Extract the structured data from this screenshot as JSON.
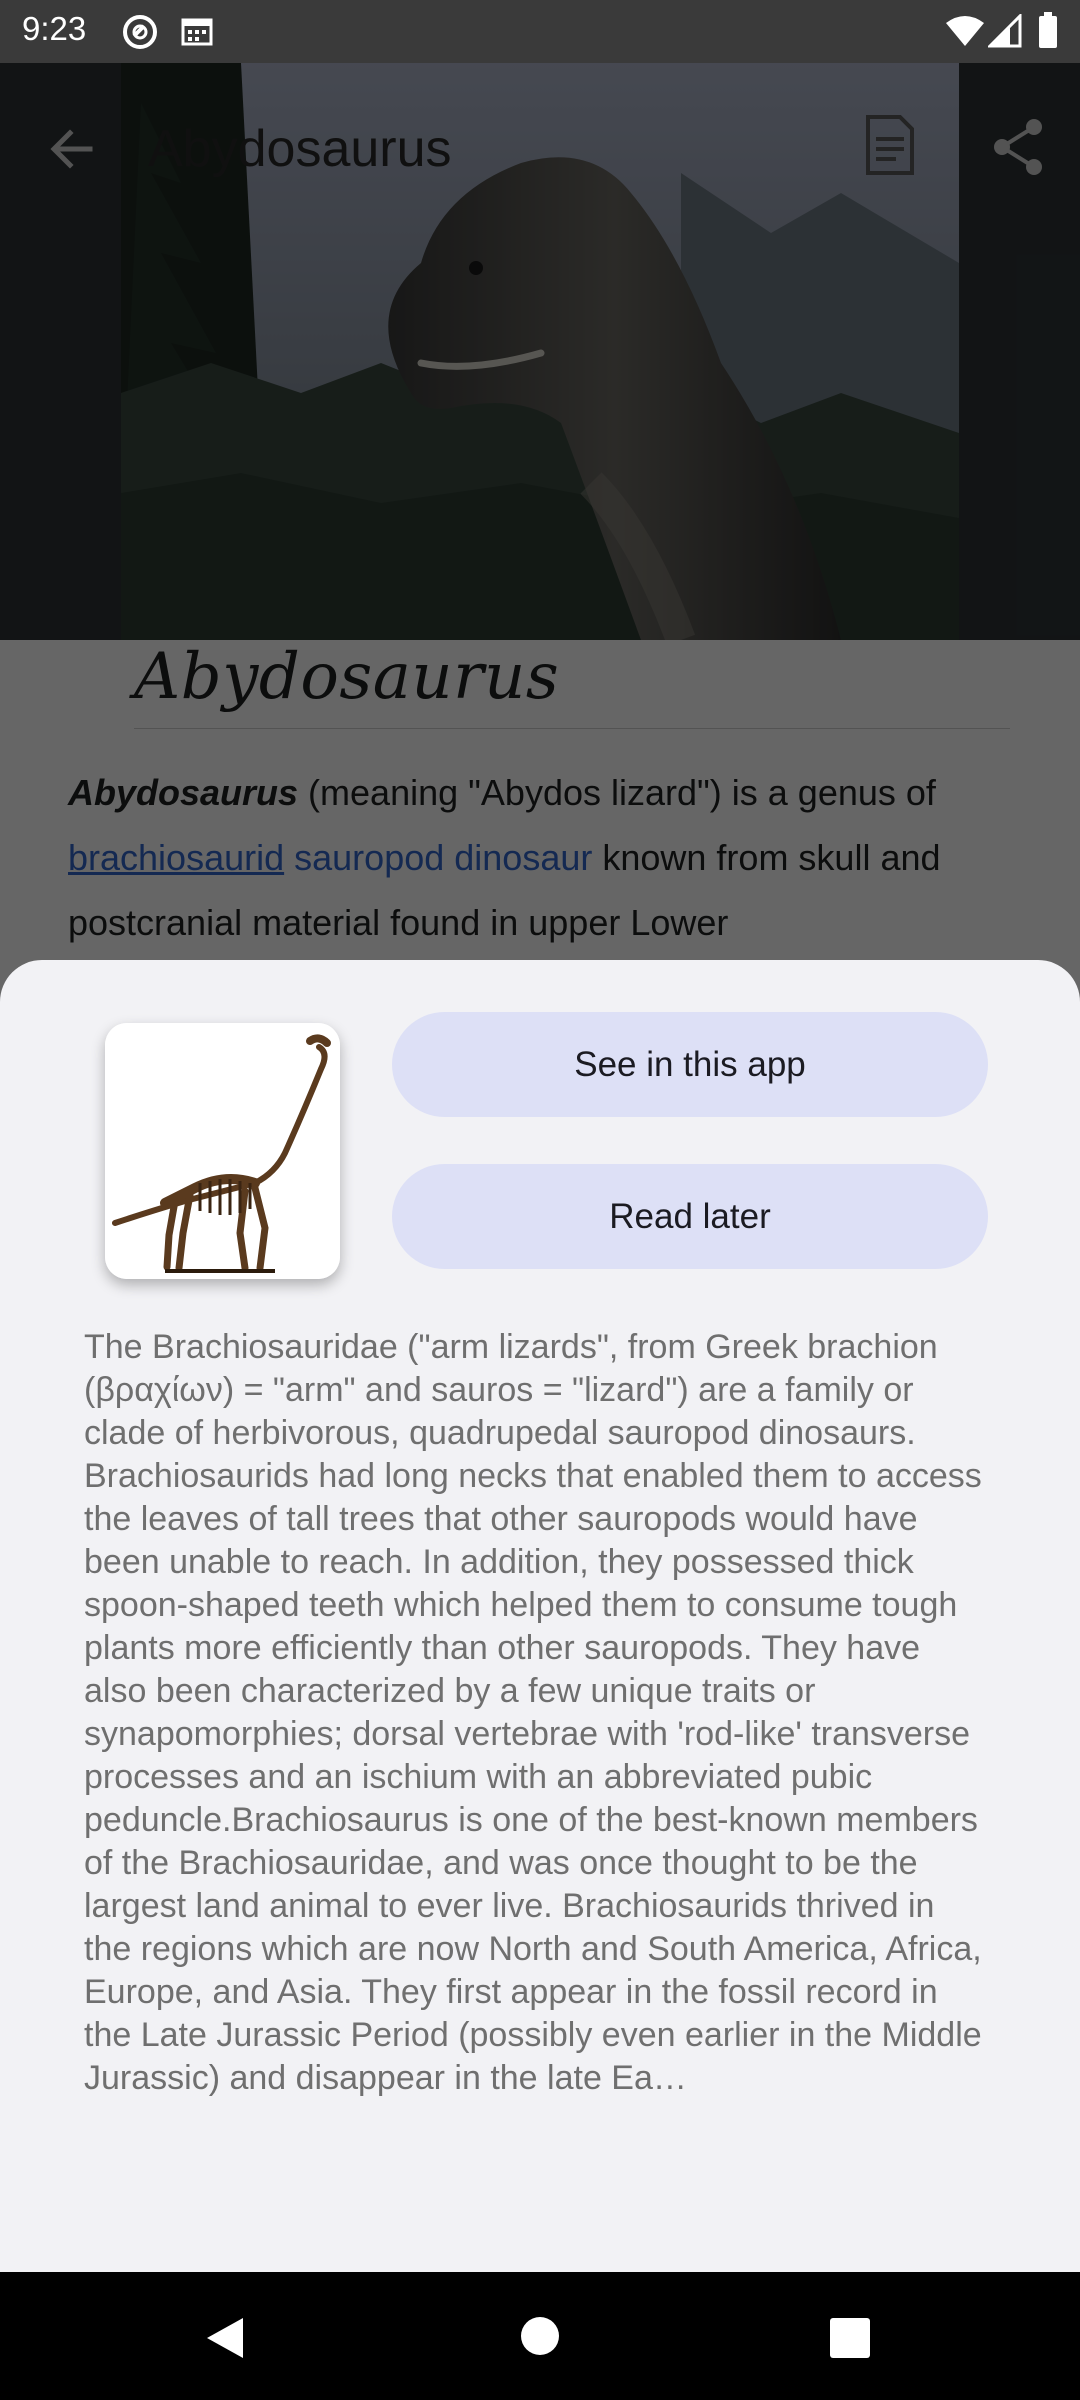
{
  "status_bar": {
    "time": "9:23"
  },
  "toolbar": {
    "title": "Abydosaurus"
  },
  "article": {
    "title": "Abydosaurus",
    "lead_bold": "Abydosaurus",
    "lead_text": " (meaning \"Abydos lizard\") is a genus of ",
    "link_brachiosaurid": "brachiosaurid",
    "link_sauropod_dinosaur": "sauropod dinosaur",
    "text_after_links": " known from skull and postcranial material found in upper Lower"
  },
  "preview_sheet": {
    "see_in_app_label": "See in this app",
    "read_later_label": "Read later",
    "extract": "The Brachiosauridae (\"arm lizards\", from Greek brachion (βραχίων) = \"arm\" and sauros = \"lizard\") are a family or clade of herbivorous, quadrupedal sauropod dinosaurs. Brachiosaurids had long necks that enabled them to access the leaves of tall trees that other sauropods would have been unable to reach. In addition, they possessed thick spoon-shaped teeth which helped them to consume tough plants more efficiently than other sauropods. They have also been characterized by a few unique traits or synapomorphies; dorsal vertebrae with 'rod-like' transverse processes and an ischium with an abbreviated pubic peduncle.Brachiosaurus is one of the best-known members of the Brachiosauridae, and was once thought to be the largest land animal to ever live. Brachiosaurids thrived in the regions which are now North and South America, Africa, Europe, and Asia. They first appear in the fossil record in the Late Jurassic Period (possibly even earlier in the Middle Jurassic) and disappear in the late Ea…"
  },
  "icons": {
    "back": "arrow-left-icon",
    "reading_list": "bookmark-list-icon",
    "share": "share-icon",
    "nav_back": "triangle-back-icon",
    "nav_home": "circle-home-icon",
    "nav_recents": "square-recents-icon"
  },
  "colors": {
    "link": "#3366cc",
    "pill_background": "#dde0f6",
    "sheet_background": "#f2f2f5"
  }
}
